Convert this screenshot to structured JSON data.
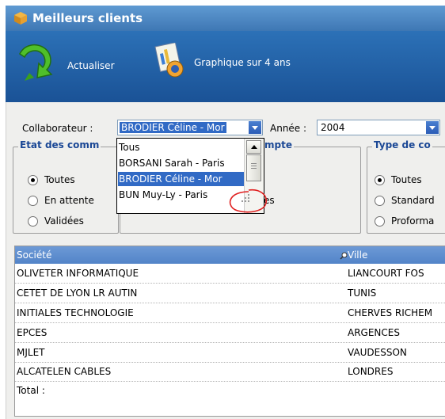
{
  "window": {
    "title": "Meilleurs clients"
  },
  "toolbar": {
    "refresh_label": "Actualiser",
    "chart_label": "Graphique sur 4 ans"
  },
  "filters": {
    "collaborateur_label": "Collaborateur :",
    "collaborateur_value": "BRODIER Céline - Mor",
    "annee_label": "Année :",
    "annee_value": "2004"
  },
  "dropdown": {
    "options": [
      "Tous",
      "BORSANI Sarah - Paris",
      "BRODIER Céline - Mor",
      "BUN Muy-Ly - Paris"
    ],
    "selected_index": 2
  },
  "groups": {
    "etat": {
      "title": "Etat des comm",
      "options": [
        "Toutes",
        "En attente",
        "Validées"
      ],
      "selected": "Toutes"
    },
    "middle": {
      "title_fragment": "mpte",
      "option_fragment": "es"
    },
    "type": {
      "title": "Type de co",
      "options": [
        "Toutes",
        "Standard",
        "Proforma"
      ],
      "selected": "Toutes"
    }
  },
  "table": {
    "headers": [
      "Société",
      "Ville"
    ],
    "rows": [
      [
        "OLIVETER INFORMATIQUE",
        "LIANCOURT FOS"
      ],
      [
        "CETET DE LYON LR AUTIN",
        "TUNIS"
      ],
      [
        "INITIALES TECHNOLOGIE",
        "CHERVES RICHEM"
      ],
      [
        "EPCES",
        "ARGENCES"
      ],
      [
        "MJLET",
        "VAUDESSON"
      ],
      [
        "ALCATELEN CABLES",
        "LONDRES"
      ]
    ],
    "total_label": "Total :"
  },
  "icons": {
    "title": "package-icon",
    "refresh": "refresh-arrow-icon",
    "chart": "chart-document-icon",
    "sort": "sort-search-icon",
    "resize": "resize-grip-icon"
  },
  "colors": {
    "titlebar": "#4a87c6",
    "toolbar": "#225fa6",
    "selection": "#316ac5",
    "group_title": "#1a4795",
    "annotation": "#e02020"
  }
}
